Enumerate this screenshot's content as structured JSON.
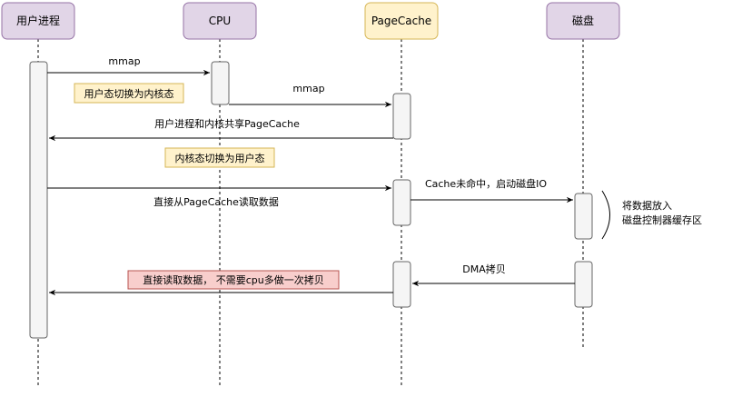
{
  "participants": {
    "user_process": {
      "label": "用户进程",
      "fill": "#e1d5e7",
      "stroke": "#9673a6"
    },
    "cpu": {
      "label": "CPU",
      "fill": "#e1d5e7",
      "stroke": "#9673a6"
    },
    "pagecache": {
      "label": "PageCache",
      "fill": "#fff2cc",
      "stroke": "#d6b656"
    },
    "disk": {
      "label": "磁盘",
      "fill": "#e1d5e7",
      "stroke": "#9673a6"
    }
  },
  "messages": {
    "m1": "mmap",
    "m2": "mmap",
    "m3": "用户进程和内核共享PageCache",
    "m4": "直接从PageCache读取数据",
    "m5": "Cache未命中，启动磁盘IO",
    "m6": "DMA拷贝"
  },
  "notes": {
    "n1": "用户态切换为内核态",
    "n2": "内核态切换为用户态",
    "n3": "直接读取数据， 不需要cpu多做一次拷贝"
  },
  "side_note": {
    "line1": "将数据放入",
    "line2": "磁盘控制器缓存区"
  },
  "colors": {
    "yellow_note_fill": "#fff2cc",
    "yellow_note_stroke": "#d6b656",
    "red_note_fill": "#f8cecc",
    "red_note_stroke": "#b85450",
    "activation_fill": "#f5f5f5",
    "activation_stroke": "#666666"
  }
}
